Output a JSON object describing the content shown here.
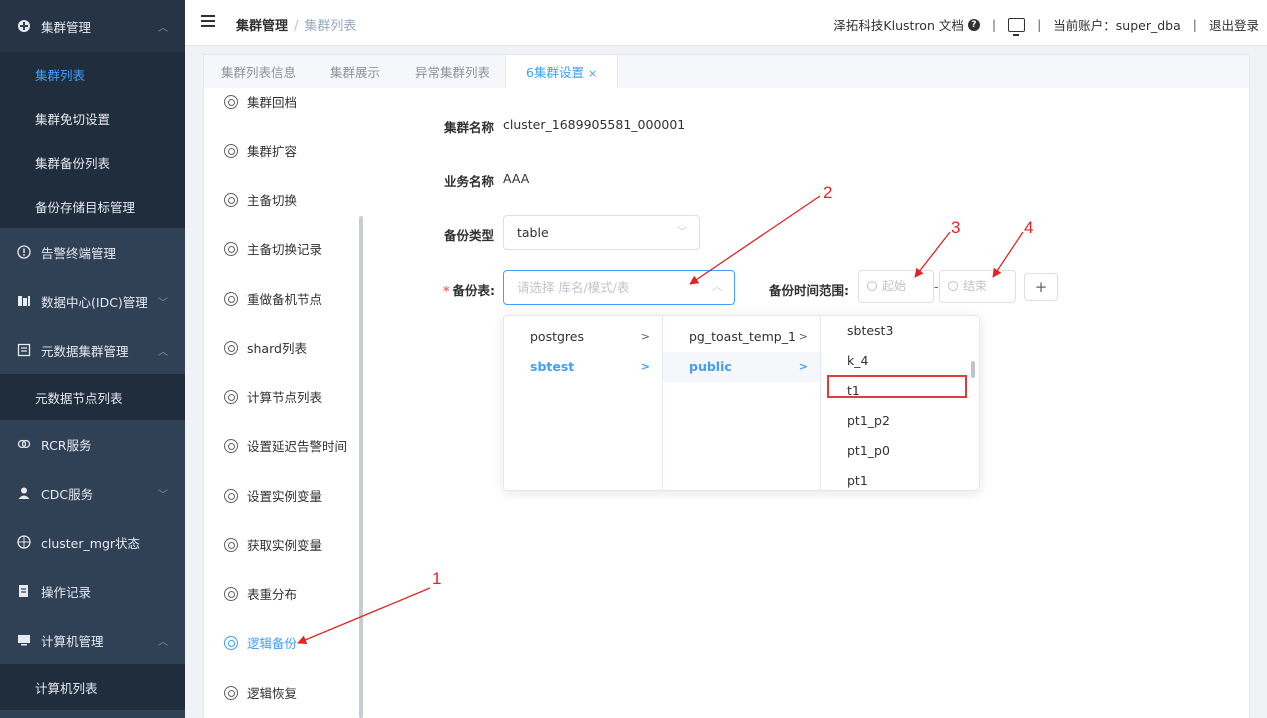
{
  "sidebar": {
    "sections": [
      {
        "label": "集群管理",
        "icon": "cluster-icon"
      },
      {
        "label": "告警终端管理",
        "icon": "alert-icon"
      },
      {
        "label": "数据中心(IDC)管理",
        "icon": "datacenter-icon"
      },
      {
        "label": "元数据集群管理",
        "icon": "metadata-icon"
      },
      {
        "label": "RCR服务",
        "icon": "link-icon"
      },
      {
        "label": "CDC服务",
        "icon": "user-icon"
      },
      {
        "label": "cluster_mgr状态",
        "icon": "compass-icon"
      },
      {
        "label": "操作记录",
        "icon": "document-icon"
      },
      {
        "label": "计算机管理",
        "icon": "computer-icon"
      }
    ],
    "cluster_sub": [
      "集群列表",
      "集群免切设置",
      "集群备份列表",
      "备份存储目标管理"
    ],
    "metadata_sub": [
      "元数据节点列表"
    ],
    "computer_sub": [
      "计算机列表"
    ]
  },
  "header": {
    "breadcrumb_1": "集群管理",
    "breadcrumb_sep": "/",
    "breadcrumb_2": "集群列表",
    "docs": "泽拓科技Klustron 文档",
    "pipe": "|",
    "account": "当前账户：super_dba",
    "logout": "退出登录"
  },
  "tabs": [
    "集群列表信息",
    "集群展示",
    "异常集群列表",
    "6集群设置"
  ],
  "tab_close": "×",
  "left_menu": [
    "集群回档",
    "集群扩容",
    "主备切换",
    "主备切换记录",
    "重做备机节点",
    "shard列表",
    "计算节点列表",
    "设置延迟告警时间",
    "设置实例变量",
    "获取实例变量",
    "表重分布",
    "逻辑备份",
    "逻辑恢复"
  ],
  "form": {
    "cluster_name_label": "集群名称",
    "cluster_name_value": "cluster_1689905581_000001",
    "biz_name_label": "业务名称",
    "biz_name_value": "AAA",
    "backup_type_label": "备份类型",
    "backup_type_value": "table",
    "required_mark": "*",
    "backup_table_label": "备份表:",
    "backup_table_placeholder": "请选择 库名/模式/表",
    "time_range_label": "备份时间范围:",
    "time_start": "起始",
    "time_dash": "-",
    "time_end": "结束",
    "add": "+"
  },
  "cascader": {
    "databases": [
      "postgres",
      "sbtest"
    ],
    "schemas": [
      "pg_toast_temp_1",
      "public"
    ],
    "tables": [
      "sbtest3",
      "k_4",
      "t1",
      "pt1_p2",
      "pt1_p0",
      "pt1"
    ]
  },
  "annotations": [
    "1",
    "2",
    "3",
    "4"
  ],
  "colors": {
    "accent": "#409eff",
    "sidebar": "#304156",
    "annotation": "#e02424"
  }
}
